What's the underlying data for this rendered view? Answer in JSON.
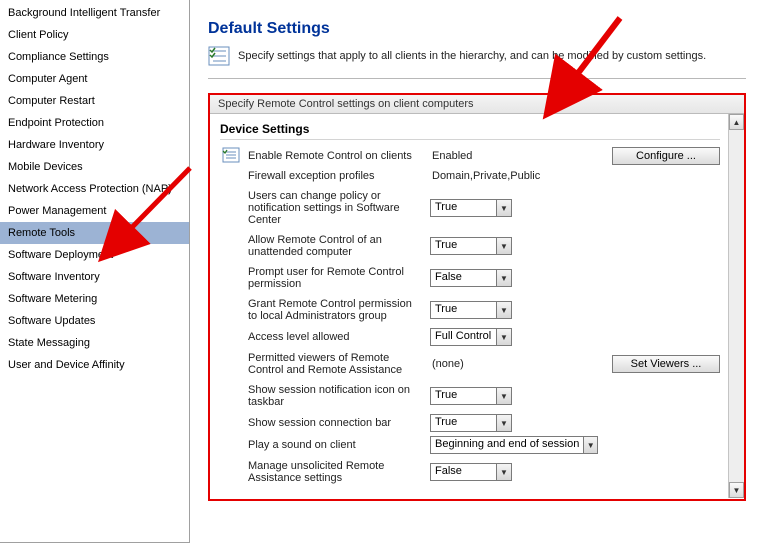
{
  "sidebar": {
    "items": [
      {
        "label": "Background Intelligent Transfer"
      },
      {
        "label": "Client Policy"
      },
      {
        "label": "Compliance Settings"
      },
      {
        "label": "Computer Agent"
      },
      {
        "label": "Computer Restart"
      },
      {
        "label": "Endpoint Protection"
      },
      {
        "label": "Hardware Inventory"
      },
      {
        "label": "Mobile Devices"
      },
      {
        "label": "Network Access Protection (NAP)"
      },
      {
        "label": "Power Management"
      },
      {
        "label": "Remote Tools"
      },
      {
        "label": "Software Deployment"
      },
      {
        "label": "Software Inventory"
      },
      {
        "label": "Software Metering"
      },
      {
        "label": "Software Updates"
      },
      {
        "label": "State Messaging"
      },
      {
        "label": "User and Device Affinity"
      }
    ],
    "selected_index": 10
  },
  "main": {
    "title": "Default Settings",
    "description": "Specify settings that apply to all clients in the hierarchy, and can be modified by custom settings.",
    "panel_caption": "Specify Remote Control settings on client computers",
    "group_title": "Device Settings",
    "configure_label": "Configure ...",
    "set_viewers_label": "Set Viewers ...",
    "rows": [
      {
        "label": "Enable Remote Control on clients",
        "type": "static",
        "value": "Enabled",
        "action": "configure"
      },
      {
        "label": "Firewall exception profiles",
        "type": "static",
        "value": "Domain,Private,Public"
      },
      {
        "label": "Users can change policy or notification settings in Software Center",
        "type": "dropdown",
        "value": "True"
      },
      {
        "label": "Allow Remote Control of an unattended computer",
        "type": "dropdown",
        "value": "True"
      },
      {
        "label": "Prompt user for Remote Control permission",
        "type": "dropdown",
        "value": "False"
      },
      {
        "label": "Grant Remote Control permission to local Administrators group",
        "type": "dropdown",
        "value": "True"
      },
      {
        "label": "Access level allowed",
        "type": "dropdown",
        "value": "Full Control"
      },
      {
        "label": "Permitted viewers of Remote Control and Remote Assistance",
        "type": "static",
        "value": "(none)",
        "action": "set_viewers"
      },
      {
        "label": "Show session notification icon on taskbar",
        "type": "dropdown",
        "value": "True"
      },
      {
        "label": "Show session connection bar",
        "type": "dropdown",
        "value": "True"
      },
      {
        "label": "Play a sound on client",
        "type": "dropdown-wide",
        "value": "Beginning and end of session"
      },
      {
        "label": "Manage unsolicited Remote Assistance settings",
        "type": "dropdown",
        "value": "False"
      }
    ]
  }
}
